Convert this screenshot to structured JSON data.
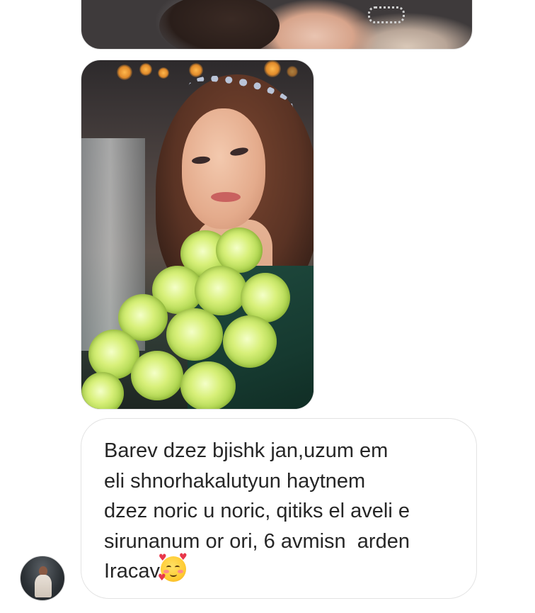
{
  "thread": {
    "messages": [
      {
        "type": "photo",
        "description_icon": "image-icon"
      },
      {
        "type": "photo",
        "description_icon": "image-icon"
      },
      {
        "type": "text",
        "lines": [
          "Barev dzez bjishk jan,uzum em",
          "eli shnorhakalutyun haytnem",
          "dzez noric u noric, qitiks el aveli e",
          "sirunanum or ori, 6 avmisn  arden",
          "Iracav"
        ],
        "emoji": "smiling-face-with-hearts"
      }
    ]
  },
  "colors": {
    "background": "#ffffff",
    "bubble_border": "#e3e3e3",
    "text": "#262626"
  }
}
